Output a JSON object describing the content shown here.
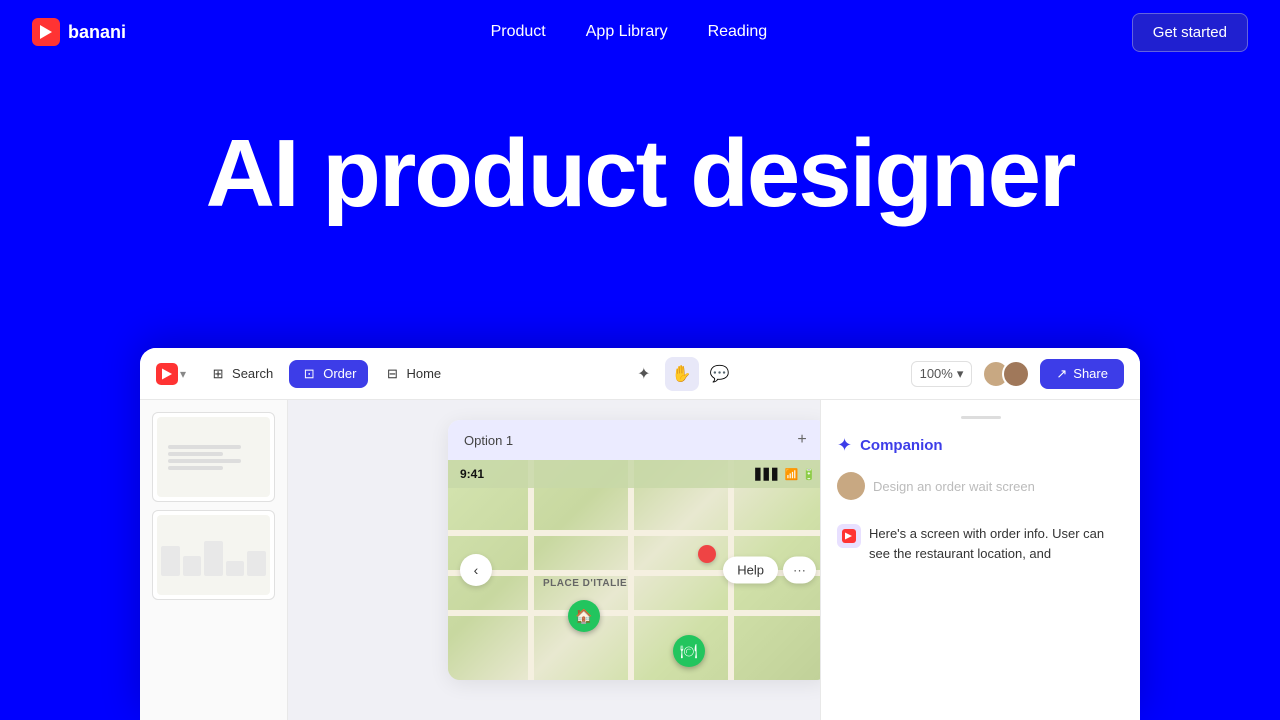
{
  "brand": {
    "name": "banani"
  },
  "navbar": {
    "product_label": "Product",
    "app_library_label": "App Library",
    "reading_label": "Reading",
    "get_started_label": "Get started"
  },
  "hero": {
    "title": "AI product designer"
  },
  "toolbar": {
    "search_label": "Search",
    "order_label": "Order",
    "home_label": "Home",
    "zoom_label": "100%",
    "share_label": "Share"
  },
  "option_card": {
    "label": "Option 1"
  },
  "status_bar": {
    "time": "9:41"
  },
  "map": {
    "place_label": "PLACE D'ITALIE",
    "back_icon": "‹",
    "help_label": "Help",
    "more_label": "···"
  },
  "companion": {
    "title": "Companion",
    "input_placeholder": "Design an order wait screen",
    "message": "Here's a screen with order info. User can see the restaurant location, and"
  },
  "icons": {
    "sparkle": "✦",
    "hand": "✋",
    "comment": "💬",
    "share_arrow": "↗",
    "star": "★",
    "banani_logo": "▶"
  }
}
